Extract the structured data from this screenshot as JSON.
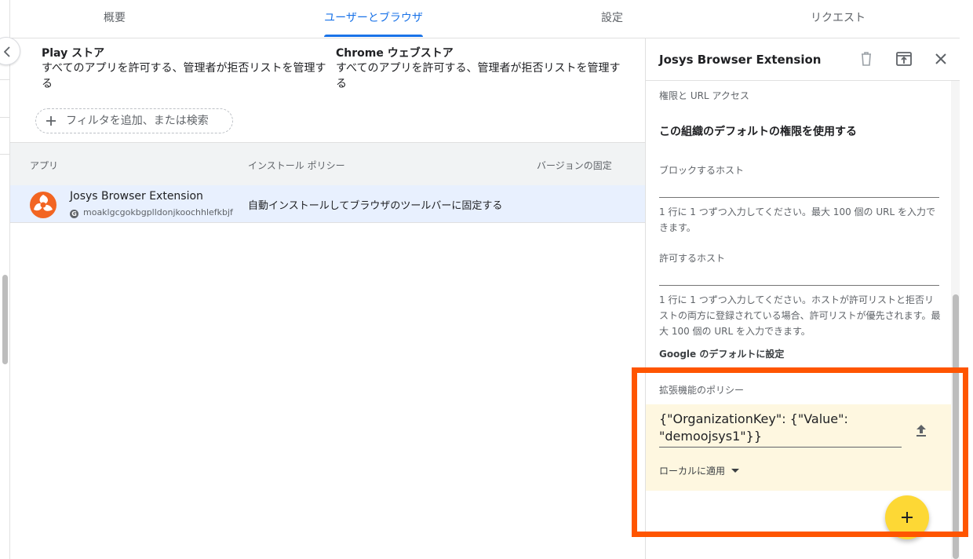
{
  "tabs": [
    {
      "label": "概要"
    },
    {
      "label": "ユーザーとブラウザ"
    },
    {
      "label": "設定"
    },
    {
      "label": "リクエスト"
    }
  ],
  "stores": {
    "play": {
      "title": "Play ストア",
      "desc": "すべてのアプリを許可する、管理者が拒否リストを管理する"
    },
    "chrome": {
      "title": "Chrome ウェブストア",
      "desc": "すべてのアプリを許可する、管理者が拒否リストを管理する"
    }
  },
  "filter": {
    "label": "フィルタを追加、または検索"
  },
  "table": {
    "headers": [
      "アプリ",
      "インストール ポリシー",
      "バージョンの固定"
    ],
    "rows": [
      {
        "name": "Josys Browser Extension",
        "id": "moaklgcgokbgplldonjkoochhlefkbjf",
        "policy": "自動インストールしてブラウザのツールバーに固定する"
      }
    ]
  },
  "panel": {
    "title": "Josys Browser Extension",
    "permissions_label": "権限と URL アクセス",
    "default_permissions": "この組織のデフォルトの権限を使用する",
    "blocked_hosts_label": "ブロックするホスト",
    "blocked_hosts_help": "1 行に 1 つずつ入力してください。最大 100 個の URL を入力できます。",
    "allowed_hosts_label": "許可するホスト",
    "allowed_hosts_help": "1 行に 1 つずつ入力してください。ホストが許可リストと拒否リストの両方に登録されている場合、許可リストが優先されます。最大 100 個の URL を入力できます。",
    "google_default": "Google のデフォルトに設定",
    "policy_label": "拡張機能のポリシー",
    "policy_value": "{\"OrganizationKey\": {\"Value\": \"demoojsys1\"}}",
    "local_apply": "ローカルに適用"
  },
  "colors": {
    "accent": "#1a73e8",
    "highlight": "#ff5500",
    "fab": "#fdd835",
    "policy_bg": "#fef7e0",
    "selected_row": "#e8f0fe"
  },
  "icons": {
    "collapse": "chevron-left-icon",
    "filter": "plus-icon",
    "delete": "trash-icon",
    "open": "open-in-new-icon",
    "close": "close-icon",
    "upload": "upload-icon",
    "fab": "plus-icon"
  }
}
